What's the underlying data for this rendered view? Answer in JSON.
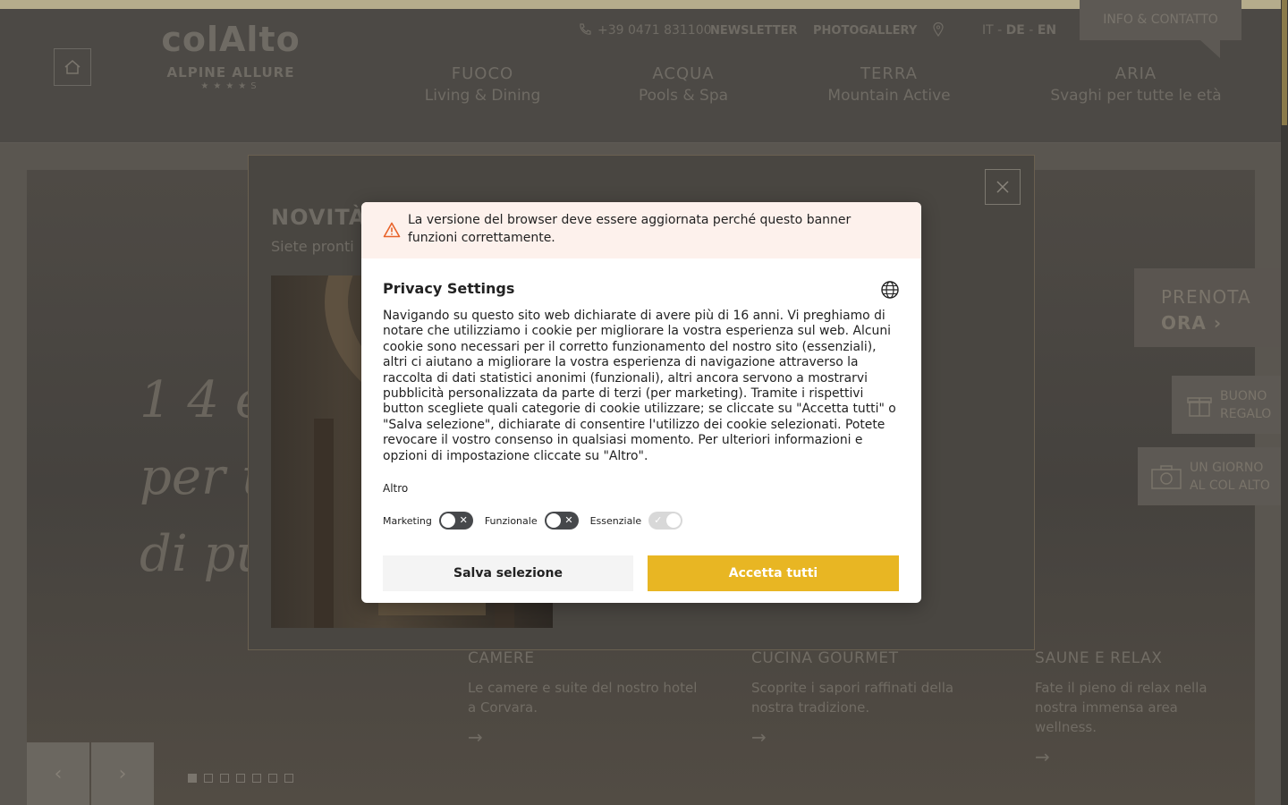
{
  "colors": {
    "accent": "#e8b623",
    "warning_bg": "#fdf1ec",
    "warning_icon": "#e8632a",
    "toggle_off": "#46484b"
  },
  "header": {
    "logo_word": "colAlto",
    "logo_sub": "ALPINE ALLURE",
    "logo_stars": "★★★★S",
    "phone": "+39 0471 831100",
    "newsletter": "NEWSLETTER",
    "photogallery": "PHOTOGALLERY",
    "lang_it": "IT",
    "lang_de": "DE",
    "lang_en": "EN",
    "lang_sep": "-",
    "info_contact": "INFO & CONTATTO",
    "nav": [
      {
        "title": "FUOCO",
        "sub": "Living & Dining"
      },
      {
        "title": "ACQUA",
        "sub": "Pools & Spa"
      },
      {
        "title": "TERRA",
        "sub": "Mountain Active"
      },
      {
        "title": "ARIA",
        "sub": "Svaghi per tutte le età"
      }
    ]
  },
  "hero": {
    "script_line1": "1 4 e",
    "script_line2": "per u",
    "script_line3": "di pur",
    "book_line1": "PRENOTA",
    "book_line2": "ORA ›",
    "gift_line1": "BUONO",
    "gift_line2": "REGALO",
    "day_line1": "UN GIORNO",
    "day_line2": "AL COL ALTO"
  },
  "cards": [
    {
      "title": "CAMERE",
      "desc": "Le camere e suite del nostro hotel a Corvara."
    },
    {
      "title": "CUCINA GOURMET",
      "desc": "Scoprite i sapori raffinati della nostra tradizione."
    },
    {
      "title": "SAUNE E RELAX",
      "desc": "Fate il pieno di relax nella nostra immensa area wellness."
    }
  ],
  "slider": {
    "prev": "‹",
    "next": "›",
    "dot_count": 7,
    "active_dot": 1
  },
  "popup": {
    "title": "NOVITÀ",
    "subtitle": "Siete pronti"
  },
  "cookie": {
    "warning": "La versione del browser deve essere aggiornata perché questo banner funzioni correttamente.",
    "title": "Privacy Settings",
    "body": "Navigando su questo sito web dichiarate di avere più di 16 anni. Vi preghiamo di notare che utilizziamo i cookie per migliorare la vostra esperienza sul web. Alcuni cookie sono necessari per il corretto funzionamento del nostro sito (essenziali), altri ci aiutano a migliorare la vostra esperienza di navigazione attraverso la raccolta di dati statistici anonimi (funzionali), altri ancora servono a mostrarvi pubblicità personalizzata da parte di terzi (per marketing). Tramite i rispettivi button scegliete quali categorie di cookie utilizzare; se cliccate su \"Accetta tutti\" o \"Salva selezione\", dichiarate di consentire l'utilizzo dei cookie selezionati. Potete revocare il vostro consenso in qualsiasi momento. Per ulteriori informazioni e opzioni di impostazione cliccate su \"Altro\".",
    "more": "Altro",
    "toggles": [
      {
        "label": "Marketing",
        "state": "off",
        "mark": "✕"
      },
      {
        "label": "Funzionale",
        "state": "off",
        "mark": "✕"
      },
      {
        "label": "Essenziale",
        "state": "on",
        "mark": "✓"
      }
    ],
    "save_label": "Salva selezione",
    "accept_label": "Accetta tutti"
  }
}
